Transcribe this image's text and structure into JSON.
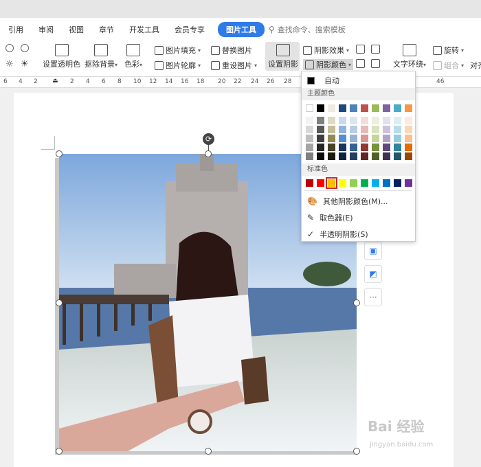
{
  "tabs": [
    "引用",
    "审阅",
    "视图",
    "章节",
    "开发工具",
    "会员专享"
  ],
  "active_tab": "图片工具",
  "search_placeholder": "查找命令、搜索模板",
  "ribbon": {
    "set_transparent": "设置透明色",
    "remove_bg": "抠除背景",
    "color": "色彩",
    "pic_fill": "图片填充",
    "pic_outline": "图片轮廓",
    "replace_pic": "替换图片",
    "reset_pic": "重设图片",
    "set_shadow": "设置阴影",
    "shadow_effect": "阴影效果",
    "shadow_color": "阴影颜色",
    "text_wrap": "文字环绕",
    "rotate": "旋转",
    "group": "组合",
    "align": "对齐"
  },
  "ruler_numbers": [
    "6",
    "4",
    "2",
    "2",
    "4",
    "6",
    "8",
    "10",
    "12",
    "14",
    "16",
    "18",
    "20",
    "22",
    "24",
    "26",
    "28",
    "46"
  ],
  "menu": {
    "auto": "自动",
    "theme_colors_label": "主题颜色",
    "standard_colors_label": "标准色",
    "more_colors": "其他阴影颜色(M)...",
    "eyedropper": "取色器(E)",
    "semi_transparent": "半透明阴影(S)"
  },
  "theme_top_row": [
    "#ffffff",
    "#000000",
    "#eeece1",
    "#1f497d",
    "#4f81bd",
    "#c0504d",
    "#9bbb59",
    "#8064a2",
    "#4bacc6",
    "#f79646"
  ],
  "theme_shades": [
    [
      "#f2f2f2",
      "#7f7f7f",
      "#ddd9c3",
      "#c6d9f0",
      "#dbe5f1",
      "#f2dcdb",
      "#ebf1dd",
      "#e5e0ec",
      "#dbeef3",
      "#fdeada"
    ],
    [
      "#d8d8d8",
      "#595959",
      "#c4bd97",
      "#8db3e2",
      "#b8cce4",
      "#e5b9b7",
      "#d7e3bc",
      "#ccc1d9",
      "#b7dde8",
      "#fbd5b5"
    ],
    [
      "#bfbfbf",
      "#3f3f3f",
      "#938953",
      "#548dd4",
      "#95b3d7",
      "#d99694",
      "#c3d69b",
      "#b2a2c7",
      "#92cddc",
      "#fac08f"
    ],
    [
      "#a5a5a5",
      "#262626",
      "#494429",
      "#17365d",
      "#366092",
      "#953734",
      "#76923c",
      "#5f497a",
      "#31859b",
      "#e36c09"
    ],
    [
      "#7f7f7f",
      "#0c0c0c",
      "#1d1b10",
      "#0f243e",
      "#244061",
      "#632423",
      "#4f6128",
      "#3f3151",
      "#205867",
      "#974806"
    ]
  ],
  "standard_colors": [
    "#c00000",
    "#ff0000",
    "#ffc000",
    "#ffff00",
    "#92d050",
    "#00b050",
    "#00b0f0",
    "#0070c0",
    "#002060",
    "#7030a0"
  ],
  "selected_standard_index": 2,
  "watermark": "Bai 经验",
  "watermark_url": "jingyan.baidu.com"
}
